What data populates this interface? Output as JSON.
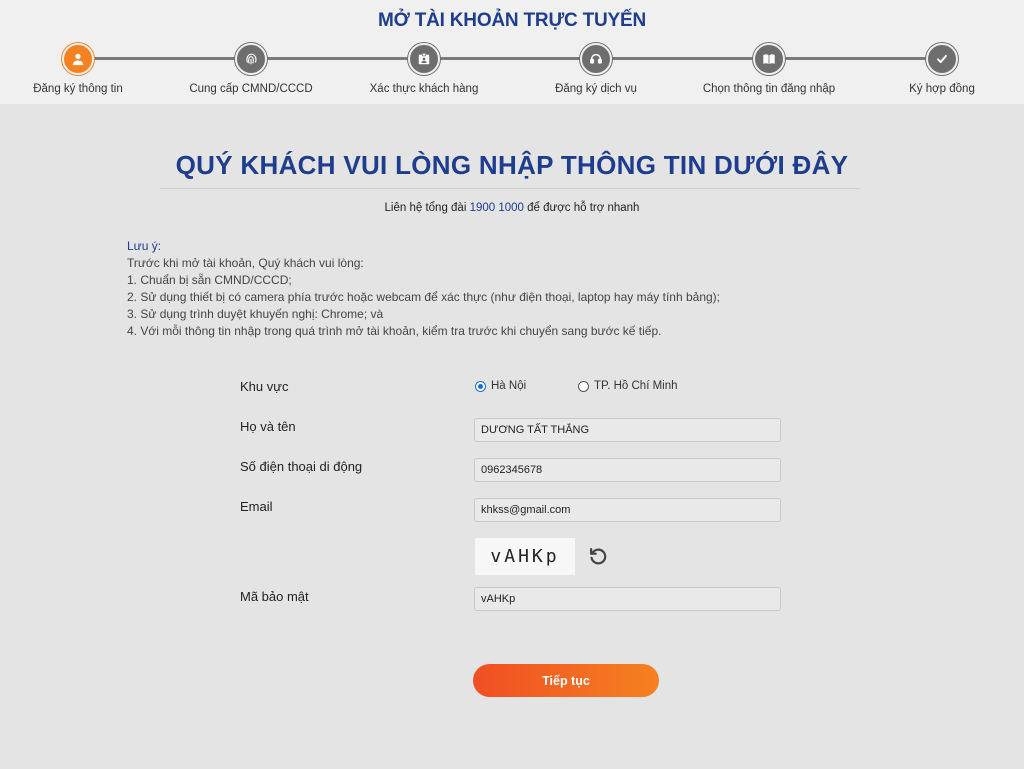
{
  "header": {
    "title": "MỞ TÀI KHOẢN TRỰC TUYẾN",
    "steps": [
      {
        "label": "Đăng ký thông tin",
        "icon": "user-icon",
        "active": true
      },
      {
        "label": "Cung cấp CMND/CCCD",
        "icon": "fingerprint-icon",
        "active": false
      },
      {
        "label": "Xác thực khách hàng",
        "icon": "id-card-icon",
        "active": false
      },
      {
        "label": "Đăng ký dịch vụ",
        "icon": "support-icon",
        "active": false
      },
      {
        "label": "Chọn thông tin đăng nhập",
        "icon": "book-icon",
        "active": false
      },
      {
        "label": "Ký hợp đồng",
        "icon": "check-icon",
        "active": false
      }
    ]
  },
  "main": {
    "title": "QUÝ KHÁCH VUI LÒNG NHẬP THÔNG TIN DƯỚI ĐÂY",
    "hotline_prefix": "Liên hệ tổng đài ",
    "hotline_number": "1900 1000",
    "hotline_suffix": " để được hỗ trợ nhanh"
  },
  "note": {
    "title": "Lưu ý:",
    "intro": "Trước khi mở tài khoản, Quý khách vui lòng:",
    "items": [
      "1. Chuẩn bị sẵn CMND/CCCD;",
      "2. Sử dụng thiết bị có camera phía trước hoặc webcam để xác thực (như điện thoại, laptop hay máy tính bảng);",
      "3. Sử dụng trình duyệt khuyến nghị: Chrome; và",
      "4. Với mỗi thông tin nhập trong quá trình mở tài khoản, kiểm tra trước khi chuyển sang bước kế tiếp."
    ]
  },
  "form": {
    "region_label": "Khu vực",
    "region_options": [
      "Hà Nội",
      "TP. Hồ Chí Minh"
    ],
    "region_selected": "Hà Nội",
    "name_label": "Họ và tên",
    "name_value": "DƯƠNG TẤT THẮNG",
    "phone_label": "Số điện thoại di động",
    "phone_value": "0962345678",
    "email_label": "Email",
    "email_value": "khkss@gmail.com",
    "captcha_text": "vAHKp",
    "security_label": "Mã bảo mật",
    "security_value": "vAHKp",
    "submit_label": "Tiếp tục"
  },
  "colors": {
    "brand_blue": "#1e3d8f",
    "accent_orange": "#f58220",
    "step_inactive": "#6e6e6e"
  }
}
